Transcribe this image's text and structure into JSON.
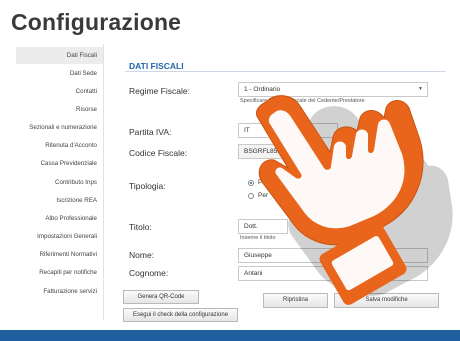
{
  "page": {
    "title": "Configurazione"
  },
  "sidebar": {
    "items": [
      {
        "label": "Dati Fiscali",
        "active": true
      },
      {
        "label": "Dati Sede"
      },
      {
        "label": "Contatti"
      },
      {
        "label": "Risorse"
      },
      {
        "label": "Sezionali e numerazione"
      },
      {
        "label": "Ritenuta d'Acconto"
      },
      {
        "label": "Cassa Previdenziale"
      },
      {
        "label": "Contributo Inps"
      },
      {
        "label": "Iscrizione REA"
      },
      {
        "label": "Albo Professionale"
      },
      {
        "label": "Impostazioni Generali"
      },
      {
        "label": "Riferimenti Normativi"
      },
      {
        "label": "Recapiti per notifiche"
      },
      {
        "label": "Fatturazione servizi"
      }
    ]
  },
  "form": {
    "section_title": "DATI FISCALI",
    "regime": {
      "label": "Regime Fiscale:",
      "value": "1 - Ordinario",
      "hint": "Specificare il regime fiscale del Cedente/Prestatore"
    },
    "piva": {
      "label": "Partita IVA:",
      "country": "IT"
    },
    "cf": {
      "label": "Codice Fiscale:",
      "value": "BSGRFL85P2"
    },
    "tipologia": {
      "label": "Tipologia:",
      "option1": "Perso",
      "option2": "Per"
    },
    "titolo": {
      "label": "Titolo:",
      "value": "Dott.",
      "hint": "Inserire il titolo"
    },
    "nome": {
      "label": "Nome:",
      "value": "Giuseppe"
    },
    "cognome": {
      "label": "Cognome:",
      "value": "Antani"
    }
  },
  "buttons": {
    "qr": "Genera QR-Code",
    "check": "Esegui il check della configurazione",
    "reset": "Ripristina",
    "save": "Salva modifiche"
  },
  "colors": {
    "accent": "#2266aa",
    "bottom_bar": "#1f5f9f",
    "hand_fill": "#e8651b"
  },
  "overlay": {
    "icon": "pointing-hand-icon"
  }
}
